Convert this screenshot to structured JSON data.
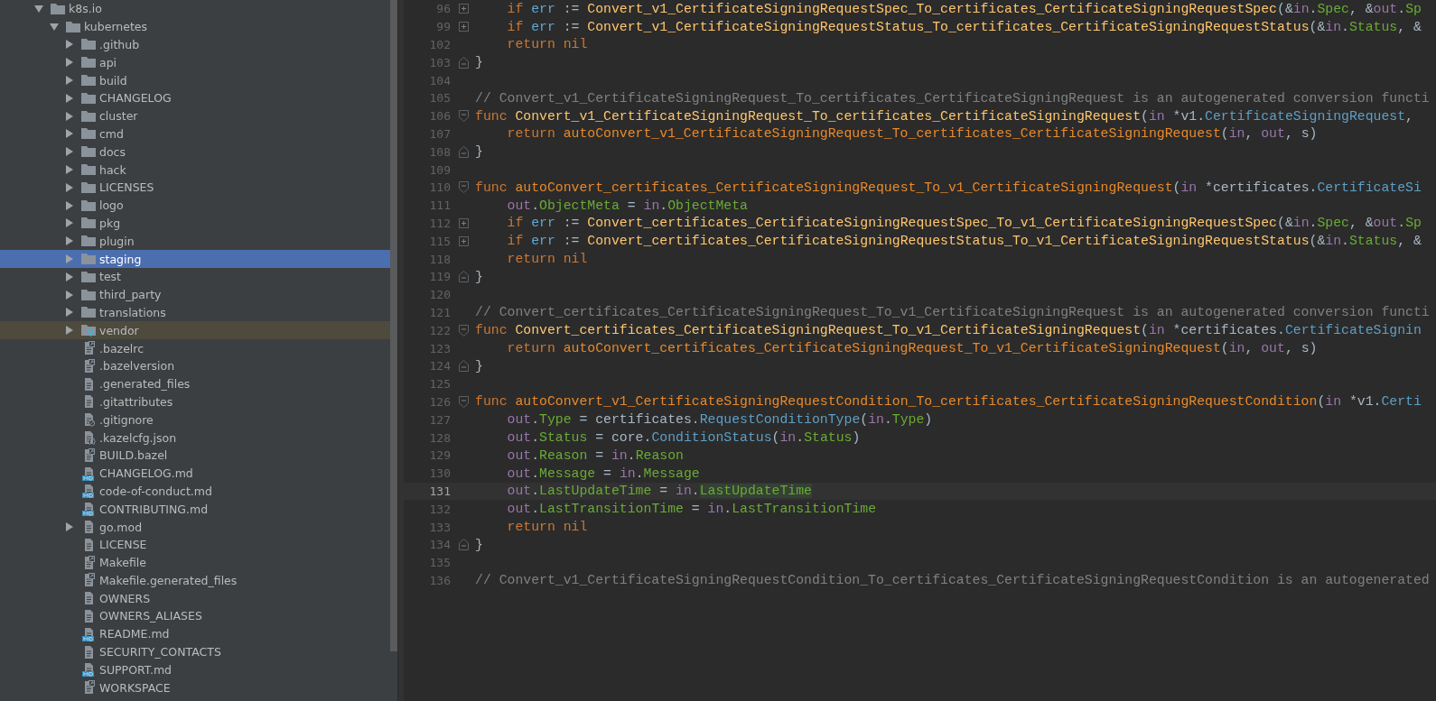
{
  "project": {
    "tree": [
      {
        "name": "k8s.io",
        "kind": "folder",
        "expanded": true,
        "selected": false,
        "excluded": false,
        "children": [
          {
            "name": "kubernetes",
            "kind": "folder",
            "expanded": true,
            "selected": false,
            "excluded": false,
            "children": [
              {
                "name": ".github",
                "kind": "folder",
                "expanded": false,
                "selected": false,
                "excluded": false
              },
              {
                "name": "api",
                "kind": "folder",
                "expanded": false,
                "selected": false,
                "excluded": false
              },
              {
                "name": "build",
                "kind": "folder",
                "expanded": false,
                "selected": false,
                "excluded": false
              },
              {
                "name": "CHANGELOG",
                "kind": "folder",
                "expanded": false,
                "selected": false,
                "excluded": false
              },
              {
                "name": "cluster",
                "kind": "folder",
                "expanded": false,
                "selected": false,
                "excluded": false
              },
              {
                "name": "cmd",
                "kind": "folder",
                "expanded": false,
                "selected": false,
                "excluded": false
              },
              {
                "name": "docs",
                "kind": "folder",
                "expanded": false,
                "selected": false,
                "excluded": false
              },
              {
                "name": "hack",
                "kind": "folder",
                "expanded": false,
                "selected": false,
                "excluded": false
              },
              {
                "name": "LICENSES",
                "kind": "folder",
                "expanded": false,
                "selected": false,
                "excluded": false
              },
              {
                "name": "logo",
                "kind": "folder",
                "expanded": false,
                "selected": false,
                "excluded": false
              },
              {
                "name": "pkg",
                "kind": "folder",
                "expanded": false,
                "selected": false,
                "excluded": false
              },
              {
                "name": "plugin",
                "kind": "folder",
                "expanded": false,
                "selected": false,
                "excluded": false
              },
              {
                "name": "staging",
                "kind": "folder",
                "expanded": false,
                "selected": true,
                "excluded": false
              },
              {
                "name": "test",
                "kind": "folder",
                "expanded": false,
                "selected": false,
                "excluded": false
              },
              {
                "name": "third_party",
                "kind": "folder",
                "expanded": false,
                "selected": false,
                "excluded": false
              },
              {
                "name": "translations",
                "kind": "folder",
                "expanded": false,
                "selected": false,
                "excluded": false
              },
              {
                "name": "vendor",
                "kind": "vendor-folder",
                "expanded": false,
                "selected": false,
                "excluded": true
              },
              {
                "name": ".bazelrc",
                "kind": "config-file",
                "selected": false,
                "excluded": false
              },
              {
                "name": ".bazelversion",
                "kind": "config-file",
                "selected": false,
                "excluded": false
              },
              {
                "name": ".generated_files",
                "kind": "text-file",
                "selected": false,
                "excluded": false
              },
              {
                "name": ".gitattributes",
                "kind": "text-file",
                "selected": false,
                "excluded": false
              },
              {
                "name": ".gitignore",
                "kind": "ignore-file",
                "selected": false,
                "excluded": false
              },
              {
                "name": ".kazelcfg.json",
                "kind": "json-file",
                "selected": false,
                "excluded": false
              },
              {
                "name": "BUILD.bazel",
                "kind": "config-file",
                "selected": false,
                "excluded": false
              },
              {
                "name": "CHANGELOG.md",
                "kind": "markdown-file",
                "selected": false,
                "excluded": false
              },
              {
                "name": "code-of-conduct.md",
                "kind": "markdown-file",
                "selected": false,
                "excluded": false
              },
              {
                "name": "CONTRIBUTING.md",
                "kind": "markdown-file",
                "selected": false,
                "excluded": false
              },
              {
                "name": "go.mod",
                "kind": "text-file",
                "expanded": false,
                "selected": false,
                "excluded": false
              },
              {
                "name": "LICENSE",
                "kind": "text-file",
                "selected": false,
                "excluded": false
              },
              {
                "name": "Makefile",
                "kind": "config-file",
                "selected": false,
                "excluded": false
              },
              {
                "name": "Makefile.generated_files",
                "kind": "config-file",
                "selected": false,
                "excluded": false
              },
              {
                "name": "OWNERS",
                "kind": "text-file",
                "selected": false,
                "excluded": false
              },
              {
                "name": "OWNERS_ALIASES",
                "kind": "text-file",
                "selected": false,
                "excluded": false
              },
              {
                "name": "README.md",
                "kind": "markdown-file",
                "selected": false,
                "excluded": false
              },
              {
                "name": "SECURITY_CONTACTS",
                "kind": "text-file",
                "selected": false,
                "excluded": false
              },
              {
                "name": "SUPPORT.md",
                "kind": "markdown-file",
                "selected": false,
                "excluded": false
              },
              {
                "name": "WORKSPACE",
                "kind": "config-file",
                "selected": false,
                "excluded": false
              }
            ]
          }
        ]
      }
    ]
  },
  "editor": {
    "lines": [
      {
        "number": "96",
        "kind": "collapsed",
        "current": false,
        "tokens": [
          {
            "kind": "keyword",
            "text": "    if"
          },
          {
            "kind": "local",
            "text": " err"
          },
          {
            "kind": "plain",
            "text": " := "
          },
          {
            "kind": "func",
            "text": "Convert_v1_CertificateSigningRequestSpec_To_certificates_CertificateSigningRequestSpec"
          },
          {
            "kind": "plain",
            "text": "(&"
          },
          {
            "kind": "param",
            "text": "in"
          },
          {
            "kind": "plain",
            "text": "."
          },
          {
            "kind": "field",
            "text": "Spec"
          },
          {
            "kind": "plain",
            "text": ", &"
          },
          {
            "kind": "param",
            "text": "out"
          },
          {
            "kind": "plain",
            "text": "."
          },
          {
            "kind": "field",
            "text": "Sp"
          }
        ]
      },
      {
        "number": "99",
        "kind": "collapsed",
        "current": false,
        "tokens": [
          {
            "kind": "keyword",
            "text": "    if"
          },
          {
            "kind": "local",
            "text": " err"
          },
          {
            "kind": "plain",
            "text": " := "
          },
          {
            "kind": "func",
            "text": "Convert_v1_CertificateSigningRequestStatus_To_certificates_CertificateSigningRequestStatus"
          },
          {
            "kind": "plain",
            "text": "(&"
          },
          {
            "kind": "param",
            "text": "in"
          },
          {
            "kind": "plain",
            "text": "."
          },
          {
            "kind": "field",
            "text": "Status"
          },
          {
            "kind": "plain",
            "text": ", &"
          }
        ]
      },
      {
        "number": "102",
        "kind": "plain",
        "current": false,
        "tokens": [
          {
            "kind": "keyword",
            "text": "    return nil"
          }
        ]
      },
      {
        "number": "103",
        "kind": "fold-end",
        "current": false,
        "tokens": [
          {
            "kind": "plain",
            "text": "}"
          }
        ]
      },
      {
        "number": "104",
        "kind": "plain",
        "current": false
      },
      {
        "number": "105",
        "kind": "plain",
        "current": false,
        "tokens": [
          {
            "kind": "comment",
            "text": "// Convert_v1_CertificateSigningRequest_To_certificates_CertificateSigningRequest is an autogenerated conversion functi"
          }
        ]
      },
      {
        "number": "106",
        "kind": "fold-start",
        "current": false,
        "tokens": [
          {
            "kind": "keyword",
            "text": "func"
          },
          {
            "kind": "func",
            "text": " Convert_v1_CertificateSigningRequest_To_certificates_CertificateSigningRequest"
          },
          {
            "kind": "plain",
            "text": "("
          },
          {
            "kind": "param",
            "text": "in"
          },
          {
            "kind": "plain",
            "text": " *v1."
          },
          {
            "kind": "type",
            "text": "CertificateSigningRequest"
          },
          {
            "kind": "plain",
            "text": ","
          }
        ]
      },
      {
        "number": "107",
        "kind": "plain",
        "current": false,
        "tokens": [
          {
            "kind": "keyword",
            "text": "    return"
          },
          {
            "kind": "private-func",
            "text": " autoConvert_v1_CertificateSigningRequest_To_certificates_CertificateSigningRequest"
          },
          {
            "kind": "plain",
            "text": "("
          },
          {
            "kind": "param",
            "text": "in"
          },
          {
            "kind": "plain",
            "text": ", "
          },
          {
            "kind": "param",
            "text": "out"
          },
          {
            "kind": "plain",
            "text": ", s)"
          }
        ]
      },
      {
        "number": "108",
        "kind": "fold-end",
        "current": false,
        "tokens": [
          {
            "kind": "plain",
            "text": "}"
          }
        ]
      },
      {
        "number": "109",
        "kind": "plain",
        "current": false
      },
      {
        "number": "110",
        "kind": "fold-start",
        "current": false,
        "tokens": [
          {
            "kind": "keyword",
            "text": "func"
          },
          {
            "kind": "private-func",
            "text": " autoConvert_certificates_CertificateSigningRequest_To_v1_CertificateSigningRequest"
          },
          {
            "kind": "plain",
            "text": "("
          },
          {
            "kind": "param",
            "text": "in"
          },
          {
            "kind": "plain",
            "text": " *certificates."
          },
          {
            "kind": "type",
            "text": "CertificateSi"
          }
        ]
      },
      {
        "number": "111",
        "kind": "plain",
        "current": false,
        "tokens": [
          {
            "kind": "param",
            "text": "    out"
          },
          {
            "kind": "plain",
            "text": "."
          },
          {
            "kind": "field",
            "text": "ObjectMeta"
          },
          {
            "kind": "plain",
            "text": " = "
          },
          {
            "kind": "param",
            "text": "in"
          },
          {
            "kind": "plain",
            "text": "."
          },
          {
            "kind": "field",
            "text": "ObjectMeta"
          }
        ]
      },
      {
        "number": "112",
        "kind": "collapsed",
        "current": false,
        "tokens": [
          {
            "kind": "keyword",
            "text": "    if"
          },
          {
            "kind": "local",
            "text": " err"
          },
          {
            "kind": "plain",
            "text": " := "
          },
          {
            "kind": "func",
            "text": "Convert_certificates_CertificateSigningRequestSpec_To_v1_CertificateSigningRequestSpec"
          },
          {
            "kind": "plain",
            "text": "(&"
          },
          {
            "kind": "param",
            "text": "in"
          },
          {
            "kind": "plain",
            "text": "."
          },
          {
            "kind": "field",
            "text": "Spec"
          },
          {
            "kind": "plain",
            "text": ", &"
          },
          {
            "kind": "param",
            "text": "out"
          },
          {
            "kind": "plain",
            "text": "."
          },
          {
            "kind": "field",
            "text": "Sp"
          }
        ]
      },
      {
        "number": "115",
        "kind": "collapsed",
        "current": false,
        "tokens": [
          {
            "kind": "keyword",
            "text": "    if"
          },
          {
            "kind": "local",
            "text": " err"
          },
          {
            "kind": "plain",
            "text": " := "
          },
          {
            "kind": "func",
            "text": "Convert_certificates_CertificateSigningRequestStatus_To_v1_CertificateSigningRequestStatus"
          },
          {
            "kind": "plain",
            "text": "(&"
          },
          {
            "kind": "param",
            "text": "in"
          },
          {
            "kind": "plain",
            "text": "."
          },
          {
            "kind": "field",
            "text": "Status"
          },
          {
            "kind": "plain",
            "text": ", &"
          }
        ]
      },
      {
        "number": "118",
        "kind": "plain",
        "current": false,
        "tokens": [
          {
            "kind": "keyword",
            "text": "    return nil"
          }
        ]
      },
      {
        "number": "119",
        "kind": "fold-end",
        "current": false,
        "tokens": [
          {
            "kind": "plain",
            "text": "}"
          }
        ]
      },
      {
        "number": "120",
        "kind": "plain",
        "current": false
      },
      {
        "number": "121",
        "kind": "plain",
        "current": false,
        "tokens": [
          {
            "kind": "comment",
            "text": "// Convert_certificates_CertificateSigningRequest_To_v1_CertificateSigningRequest is an autogenerated conversion functi"
          }
        ]
      },
      {
        "number": "122",
        "kind": "fold-start",
        "current": false,
        "tokens": [
          {
            "kind": "keyword",
            "text": "func"
          },
          {
            "kind": "func",
            "text": " Convert_certificates_CertificateSigningRequest_To_v1_CertificateSigningRequest"
          },
          {
            "kind": "plain",
            "text": "("
          },
          {
            "kind": "param",
            "text": "in"
          },
          {
            "kind": "plain",
            "text": " *certificates."
          },
          {
            "kind": "type",
            "text": "CertificateSignin"
          }
        ]
      },
      {
        "number": "123",
        "kind": "plain",
        "current": false,
        "tokens": [
          {
            "kind": "keyword",
            "text": "    return"
          },
          {
            "kind": "private-func",
            "text": " autoConvert_certificates_CertificateSigningRequest_To_v1_CertificateSigningRequest"
          },
          {
            "kind": "plain",
            "text": "("
          },
          {
            "kind": "param",
            "text": "in"
          },
          {
            "kind": "plain",
            "text": ", "
          },
          {
            "kind": "param",
            "text": "out"
          },
          {
            "kind": "plain",
            "text": ", s)"
          }
        ]
      },
      {
        "number": "124",
        "kind": "fold-end",
        "current": false,
        "tokens": [
          {
            "kind": "plain",
            "text": "}"
          }
        ]
      },
      {
        "number": "125",
        "kind": "plain",
        "current": false
      },
      {
        "number": "126",
        "kind": "fold-start",
        "current": false,
        "tokens": [
          {
            "kind": "keyword",
            "text": "func"
          },
          {
            "kind": "private-func",
            "text": " autoConvert_v1_CertificateSigningRequestCondition_To_certificates_CertificateSigningRequestCondition"
          },
          {
            "kind": "plain",
            "text": "("
          },
          {
            "kind": "param",
            "text": "in"
          },
          {
            "kind": "plain",
            "text": " *v1."
          },
          {
            "kind": "type",
            "text": "Certi"
          }
        ]
      },
      {
        "number": "127",
        "kind": "plain",
        "current": false,
        "tokens": [
          {
            "kind": "param",
            "text": "    out"
          },
          {
            "kind": "plain",
            "text": "."
          },
          {
            "kind": "field",
            "text": "Type"
          },
          {
            "kind": "plain",
            "text": " = certificates."
          },
          {
            "kind": "type",
            "text": "RequestConditionType"
          },
          {
            "kind": "plain",
            "text": "("
          },
          {
            "kind": "param",
            "text": "in"
          },
          {
            "kind": "plain",
            "text": "."
          },
          {
            "kind": "field",
            "text": "Type"
          },
          {
            "kind": "plain",
            "text": ")"
          }
        ]
      },
      {
        "number": "128",
        "kind": "plain",
        "current": false,
        "tokens": [
          {
            "kind": "param",
            "text": "    out"
          },
          {
            "kind": "plain",
            "text": "."
          },
          {
            "kind": "field",
            "text": "Status"
          },
          {
            "kind": "plain",
            "text": " = core."
          },
          {
            "kind": "type",
            "text": "ConditionStatus"
          },
          {
            "kind": "plain",
            "text": "("
          },
          {
            "kind": "param",
            "text": "in"
          },
          {
            "kind": "plain",
            "text": "."
          },
          {
            "kind": "field",
            "text": "Status"
          },
          {
            "kind": "plain",
            "text": ")"
          }
        ]
      },
      {
        "number": "129",
        "kind": "plain",
        "current": false,
        "tokens": [
          {
            "kind": "param",
            "text": "    out"
          },
          {
            "kind": "plain",
            "text": "."
          },
          {
            "kind": "field",
            "text": "Reason"
          },
          {
            "kind": "plain",
            "text": " = "
          },
          {
            "kind": "param",
            "text": "in"
          },
          {
            "kind": "plain",
            "text": "."
          },
          {
            "kind": "field",
            "text": "Reason"
          }
        ]
      },
      {
        "number": "130",
        "kind": "plain",
        "current": false,
        "tokens": [
          {
            "kind": "param",
            "text": "    out"
          },
          {
            "kind": "plain",
            "text": "."
          },
          {
            "kind": "field",
            "text": "Message"
          },
          {
            "kind": "plain",
            "text": " = "
          },
          {
            "kind": "param",
            "text": "in"
          },
          {
            "kind": "plain",
            "text": "."
          },
          {
            "kind": "field",
            "text": "Message"
          }
        ]
      },
      {
        "number": "131",
        "kind": "plain",
        "current": true,
        "tokens": [
          {
            "kind": "param",
            "text": "    out"
          },
          {
            "kind": "plain",
            "text": "."
          },
          {
            "kind": "field",
            "text": "LastUpdateTime"
          },
          {
            "kind": "plain",
            "text": " = "
          },
          {
            "kind": "param",
            "text": "in"
          },
          {
            "kind": "plain",
            "text": "."
          },
          {
            "kind": "match",
            "text": "LastUpdateTime"
          }
        ]
      },
      {
        "number": "132",
        "kind": "plain",
        "current": false,
        "tokens": [
          {
            "kind": "param",
            "text": "    out"
          },
          {
            "kind": "plain",
            "text": "."
          },
          {
            "kind": "field",
            "text": "LastTransitionTime"
          },
          {
            "kind": "plain",
            "text": " = "
          },
          {
            "kind": "param",
            "text": "in"
          },
          {
            "kind": "plain",
            "text": "."
          },
          {
            "kind": "field",
            "text": "LastTransitionTime"
          }
        ]
      },
      {
        "number": "133",
        "kind": "plain",
        "current": false,
        "tokens": [
          {
            "kind": "keyword",
            "text": "    return nil"
          }
        ]
      },
      {
        "number": "134",
        "kind": "fold-end",
        "current": false,
        "tokens": [
          {
            "kind": "plain",
            "text": "}"
          }
        ]
      },
      {
        "number": "135",
        "kind": "plain",
        "current": false
      },
      {
        "number": "136",
        "kind": "plain",
        "current": false,
        "tokens": [
          {
            "kind": "comment",
            "text": "// Convert_v1_CertificateSigningRequestCondition_To_certificates_CertificateSigningRequestCondition is an autogenerated"
          }
        ]
      }
    ]
  }
}
